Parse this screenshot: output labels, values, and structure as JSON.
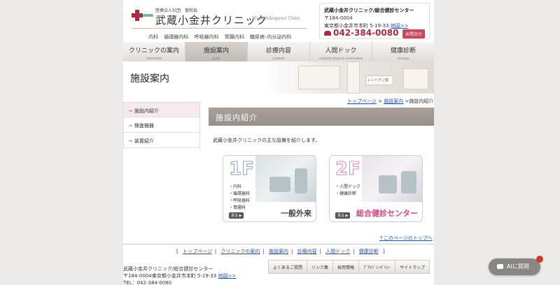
{
  "header": {
    "logo_kanwa": "KANWA",
    "logo_corp": "医療法人社団　寛和会",
    "logo_name": "武蔵小金井クリニック",
    "logo_en": "Musashikoganei Clinic",
    "departments": [
      "内科",
      "循環器内科",
      "呼吸器内科",
      "胃腸内科",
      "糖尿病･内分泌内科"
    ]
  },
  "contact": {
    "name": "武蔵小金井クリニック/総合健診センター",
    "postal": "〒184-0004",
    "address": "東京都小金井市本町 5-19-33",
    "map_link": "地図>>",
    "tel": "042-384-0080",
    "inquiry_label": "お問合せ"
  },
  "nav": [
    {
      "jp": "クリニックの案内",
      "en": "information"
    },
    {
      "jp": "施設案内",
      "en": "guide"
    },
    {
      "jp": "診療内容",
      "en": "contents"
    },
    {
      "jp": "人間ドック",
      "en": "complete physical examination"
    },
    {
      "jp": "健康診断",
      "en": "checkup"
    }
  ],
  "hero": {
    "title": "施設案内",
    "sign": "レントゲン室"
  },
  "breadcrumb": {
    "home": "トップページ",
    "sep": ">",
    "parent": "施設案内",
    "current": "施設内紹介"
  },
  "sidebar": {
    "items": [
      {
        "label": "施設内紹介"
      },
      {
        "label": "検査機器"
      },
      {
        "label": "装置紹介"
      }
    ]
  },
  "main": {
    "section_title": "施設内紹介",
    "intro": "武蔵小金井クリニックの主な設備を紹介します。",
    "cards": [
      {
        "floor": "1F",
        "items": [
          "・内科",
          "・循環器科",
          "・呼吸器科",
          "・胃腸科"
        ],
        "title": "一般外来",
        "more": "見る ▶"
      },
      {
        "floor": "2F",
        "items": [
          "・人間ドック",
          "・健康診断"
        ],
        "title": "総合健診センター",
        "more": "見る ▶"
      }
    ]
  },
  "footer": {
    "pagetop": "↑このページのトップへ",
    "nav_open": "[",
    "nav_close": "]",
    "nav_links": [
      "トップページ",
      "クリニックの案内",
      "施設案内",
      "診療内容",
      "人間ドック",
      "健康診断"
    ],
    "addr_name": "武蔵小金井クリニック/総合健診センター",
    "addr_line": "〒184-0004東京都小金井市本町 5-19-33",
    "addr_map": "地図>>",
    "addr_tel": "TEL：042-384-0080",
    "buttons": [
      "よくあるご質問",
      "リンク集",
      "採用情報",
      "ﾌﾟﾗｲﾊﾞｼｰﾎﾟﾘｼｰ",
      "サイトマップ"
    ]
  },
  "ai_button": {
    "label": "AIに質問"
  },
  "colors": {
    "accent": "#c44a5b",
    "nav_active": "#c2bbb6",
    "section_header": "#a0978f",
    "link": "#2a53b3"
  }
}
